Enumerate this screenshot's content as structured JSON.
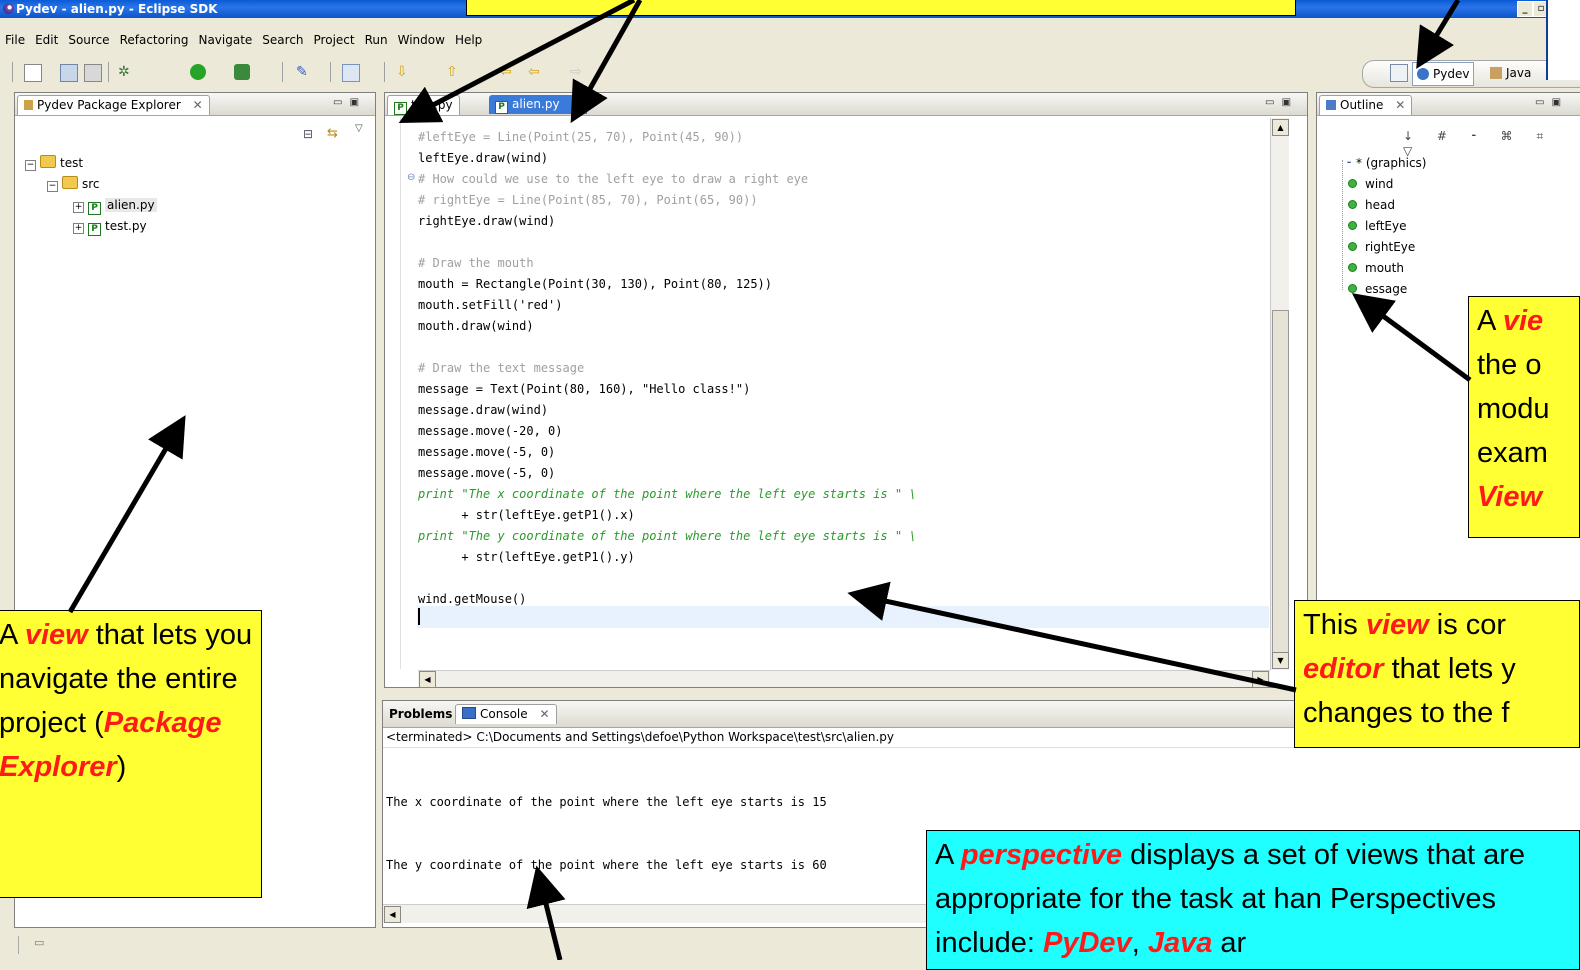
{
  "window": {
    "title": "Pydev - alien.py - Eclipse SDK"
  },
  "menu": [
    "File",
    "Edit",
    "Source",
    "Refactoring",
    "Navigate",
    "Search",
    "Project",
    "Run",
    "Window",
    "Help"
  ],
  "perspectives": {
    "pydev": "Pydev",
    "java": "Java"
  },
  "explorer": {
    "title": "Pydev Package Explorer",
    "tree": {
      "project": "test",
      "folder": "src",
      "files": [
        "alien.py",
        "test.py"
      ]
    }
  },
  "editor": {
    "tabs": [
      "test.py",
      "alien.py"
    ],
    "lines": [
      "#leftEye = Line(Point(25, 70), Point(45, 90))",
      "leftEye.draw(wind)",
      "# How could we use to the left eye to draw a right eye",
      "# rightEye = Line(Point(85, 70), Point(65, 90))",
      "rightEye.draw(wind)",
      "",
      "# Draw the mouth",
      "mouth = Rectangle(Point(30, 130), Point(80, 125))",
      "mouth.setFill('red')",
      "mouth.draw(wind)",
      "",
      "# Draw the text message",
      "message = Text(Point(80, 160), \"Hello class!\")",
      "message.draw(wind)",
      "message.move(-20, 0)",
      "message.move(-5, 0)",
      "message.move(-5, 0)",
      "print \"The x coordinate of the point where the left eye starts is \" \\",
      "      + str(leftEye.getP1().x)",
      "print \"The y coordinate of the point where the left eye starts is \" \\",
      "      + str(leftEye.getP1().y)",
      "",
      "wind.getMouse()"
    ]
  },
  "outline": {
    "title": "Outline",
    "items": [
      "* (graphics)",
      "wind",
      "head",
      "leftEye",
      "rightEye",
      "mouth",
      "essage"
    ]
  },
  "console": {
    "tabs": [
      "Problems",
      "Console"
    ],
    "status": "<terminated> C:\\Documents and Settings\\defoe\\Python Workspace\\test\\src\\alien.py",
    "output": [
      "The x coordinate of the point where the left eye starts is 15",
      "The y coordinate of the point where the left eye starts is 60"
    ]
  },
  "callouts": {
    "explorer": {
      "a": "A ",
      "view": "view",
      "b": " that lets you navigate the entire project (",
      "pe": "Package Explorer",
      "c": ")"
    },
    "outline": {
      "a": "A ",
      "view": "vie",
      "b": " the o modu exam ",
      "ov": "View"
    },
    "editor": {
      "a": "This ",
      "view": "view",
      "b": " is cor ",
      "ed": "editor",
      "c": " that lets y changes to the f"
    },
    "perspective": {
      "a": "A ",
      "p": "perspective",
      "b": " displays a set of views that are appropriate for the task at han Perspectives include: ",
      "pd": "PyDev",
      "c": ", ",
      "jv": "Java",
      "d": " ar"
    }
  }
}
